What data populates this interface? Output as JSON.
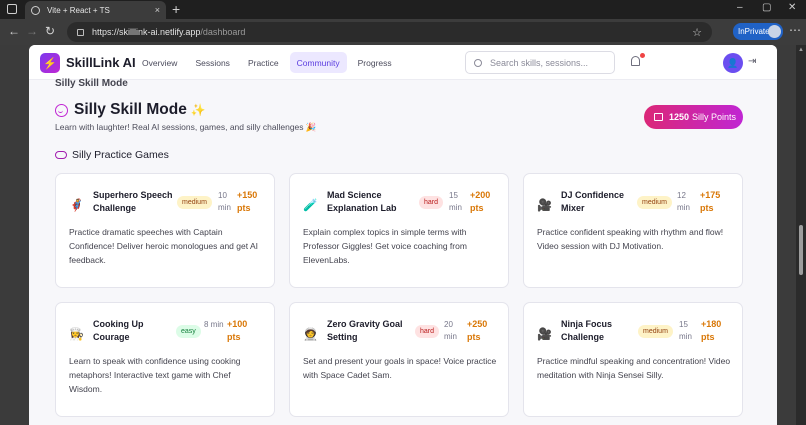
{
  "browser": {
    "tab_title": "Vite + React + TS",
    "tab_close": "×",
    "new_tab": "+",
    "url_host": "https://skilllink-ai.netlify.app",
    "url_path": "/dashboard",
    "inprivate_label": "InPrivate",
    "window_controls": {
      "minimize": "–",
      "maximize": "▢",
      "close": "✕"
    },
    "nav": {
      "back": "←",
      "forward": "→",
      "refresh": "↻"
    }
  },
  "app": {
    "brand": "SkillLink AI",
    "logo_glyph": "⚡",
    "nav_links": [
      {
        "label": "Overview",
        "active": false
      },
      {
        "label": "Sessions",
        "active": false
      },
      {
        "label": "Practice",
        "active": false
      },
      {
        "label": "Community",
        "active": true
      },
      {
        "label": "Progress",
        "active": false
      }
    ],
    "search_placeholder": "Search skills, sessions...",
    "avatar_glyph": "👤",
    "logout_glyph": "⇥"
  },
  "silly": {
    "cut_heading": "Silly Skill Mode",
    "title": "Silly Skill Mode",
    "subtitle": "Learn with laughter! Real AI sessions, games, and silly challenges 🎉",
    "points_value": "1250",
    "points_label": "Silly Points",
    "games_heading": "Silly Practice Games"
  },
  "games": [
    {
      "emoji": "🦸",
      "title": "Superhero Speech Challenge",
      "difficulty": "medium",
      "duration": "10 min",
      "points": "+150 pts",
      "description": "Practice dramatic speeches with Captain Confidence! Deliver heroic monologues and get AI feedback."
    },
    {
      "emoji": "🧪",
      "title": "Mad Science Explanation Lab",
      "difficulty": "hard",
      "duration": "15 min",
      "points": "+200 pts",
      "description": "Explain complex topics in simple terms with Professor Giggles! Get voice coaching from ElevenLabs."
    },
    {
      "emoji": "🎥",
      "title": "DJ Confidence Mixer",
      "difficulty": "medium",
      "duration": "12 min",
      "points": "+175 pts",
      "description": "Practice confident speaking with rhythm and flow! Video session with DJ Motivation."
    },
    {
      "emoji": "👩‍🍳",
      "title": "Cooking Up Courage",
      "difficulty": "easy",
      "duration": "8 min",
      "points": "+100 pts",
      "description": "Learn to speak with confidence using cooking metaphors! Interactive text game with Chef Wisdom."
    },
    {
      "emoji": "🧑‍🚀",
      "title": "Zero Gravity Goal Setting",
      "difficulty": "hard",
      "duration": "20 min",
      "points": "+250 pts",
      "description": "Set and present your goals in space! Voice practice with Space Cadet Sam."
    },
    {
      "emoji": "🎥",
      "title": "Ninja Focus Challenge",
      "difficulty": "medium",
      "duration": "15 min",
      "points": "+180 pts",
      "description": "Practice mindful speaking and concentration! Video meditation with Ninja Sensei Silly."
    }
  ]
}
